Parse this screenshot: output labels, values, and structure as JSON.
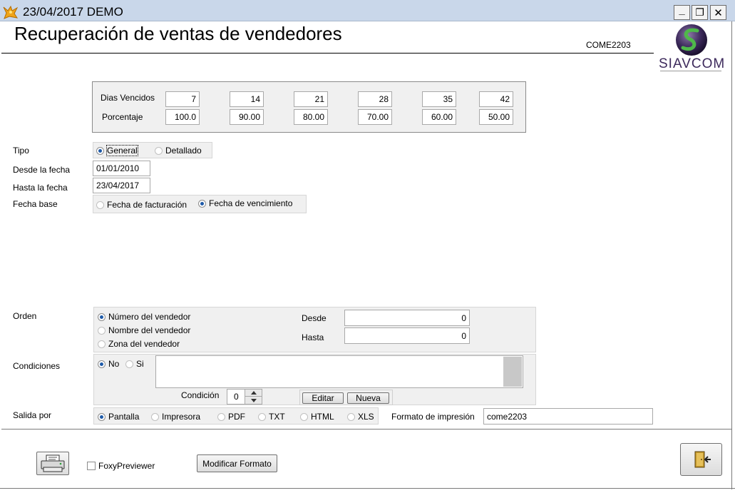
{
  "window": {
    "title": "23/04/2017  DEMO",
    "main_title": "Recuperación de ventas de vendedores",
    "form_code": "COME2203",
    "logo_text": "SIAVCOM",
    "controls": {
      "minimize": "_",
      "restore": "❐",
      "close": "✕"
    }
  },
  "dias": {
    "label_dias": "Dias Vencidos",
    "label_porcentaje": "Porcentaje",
    "dias_values": [
      "7",
      "14",
      "21",
      "28",
      "35",
      "42"
    ],
    "porcentaje_values": [
      "100.0",
      "90.00",
      "80.00",
      "70.00",
      "60.00",
      "50.00"
    ]
  },
  "tipo": {
    "label": "Tipo",
    "options": [
      "General",
      "Detallado"
    ],
    "selected": "General"
  },
  "desde_fecha": {
    "label": "Desde la fecha",
    "value": "01/01/2010"
  },
  "hasta_fecha": {
    "label": "Hasta la fecha",
    "value": "23/04/2017"
  },
  "fecha_base": {
    "label": "Fecha base",
    "options": [
      "Fecha de facturación",
      "Fecha de vencimiento"
    ],
    "selected": "Fecha de vencimiento"
  },
  "orden": {
    "label": "Orden",
    "options": [
      "Número del vendedor",
      "Nombre del vendedor",
      "Zona del vendedor"
    ],
    "selected": "Número del vendedor",
    "desde_label": "Desde",
    "desde_value": "0",
    "hasta_label": "Hasta",
    "hasta_value": "0"
  },
  "condiciones": {
    "label": "Condiciones",
    "options": [
      "No",
      "Si"
    ],
    "selected": "No",
    "condicion_label": "Condición",
    "condicion_value": "0",
    "editar_label": "Editar",
    "nueva_label": "Nueva"
  },
  "salida": {
    "label": "Salida por",
    "options": [
      "Pantalla",
      "Impresora",
      "PDF",
      "TXT",
      "HTML",
      "XLS"
    ],
    "selected": "Pantalla",
    "formato_label": "Formato de impresión",
    "formato_value": "come2203"
  },
  "bottom": {
    "foxy_label": "FoxyPreviewer",
    "foxy_checked": false,
    "modificar_label": "Modificar Formato"
  }
}
